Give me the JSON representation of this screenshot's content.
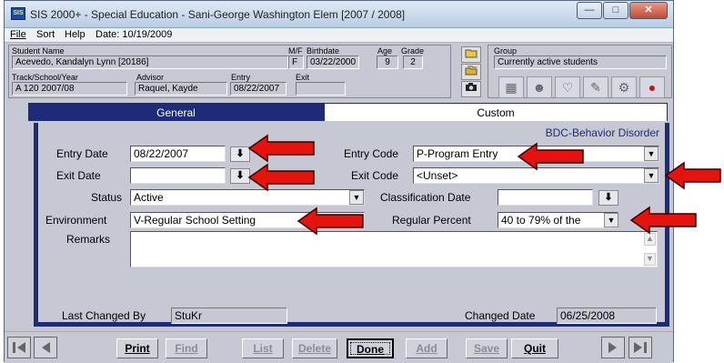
{
  "window": {
    "title": "SIS 2000+ - Special Education - Sani-George Washington Elem [2007 / 2008]",
    "app_icon": "sis-app-icon",
    "controls": [
      "minimize",
      "maximize",
      "close"
    ]
  },
  "menu": {
    "file": "File",
    "sort": "Sort",
    "help": "Help",
    "date": "Date: 10/19/2009"
  },
  "student": {
    "name_label": "Student Name",
    "name": "Acevedo, Kandalyn Lynn  [20186]",
    "mf_label": "M/F",
    "mf": "F",
    "birthdate_label": "Birthdate",
    "birthdate": "03/22/2000",
    "age_label": "Age",
    "age": "9",
    "grade_label": "Grade",
    "grade": "2",
    "track_label": "Track/School/Year",
    "track": "A 120 2007/08",
    "advisor_label": "Advisor",
    "advisor": "Raquel, Kayde",
    "entry_label": "Entry",
    "entry": "08/22/2007",
    "exit_label": "Exit",
    "exit": ""
  },
  "group": {
    "label": "Group",
    "value": "Currently active students"
  },
  "tabs": [
    {
      "label": "General",
      "active": true
    },
    {
      "label": "Custom",
      "active": false
    }
  ],
  "form": {
    "disability": "BDC-Behavior Disorder",
    "entry_date_label": "Entry Date",
    "entry_date": "08/22/2007",
    "exit_date_label": "Exit Date",
    "exit_date": "",
    "status_label": "Status",
    "status": "Active",
    "environment_label": "Environment",
    "environment": "V-Regular School Setting",
    "remarks_label": "Remarks",
    "remarks": "",
    "entry_code_label": "Entry Code",
    "entry_code": "P-Program Entry",
    "exit_code_label": "Exit Code",
    "exit_code": "<Unset>",
    "classification_label": "Classification Date",
    "classification_date": "",
    "regular_percent_label": "Regular Percent",
    "regular_percent": "40 to 79% of the",
    "last_changed_label": "Last Changed By",
    "last_changed_by": "StuKr",
    "changed_date_label": "Changed Date",
    "changed_date": "06/25/2008"
  },
  "buttons": {
    "print": "Print",
    "find": "Find",
    "list": "List",
    "delete": "Delete",
    "done": "Done",
    "add": "Add",
    "save": "Save",
    "quit": "Quit"
  },
  "colors": {
    "tab_active": "#1e2c78",
    "panel_border": "#1e2c78",
    "annotation_arrow": "#e8120c",
    "disability_text": "#1e2c78"
  }
}
